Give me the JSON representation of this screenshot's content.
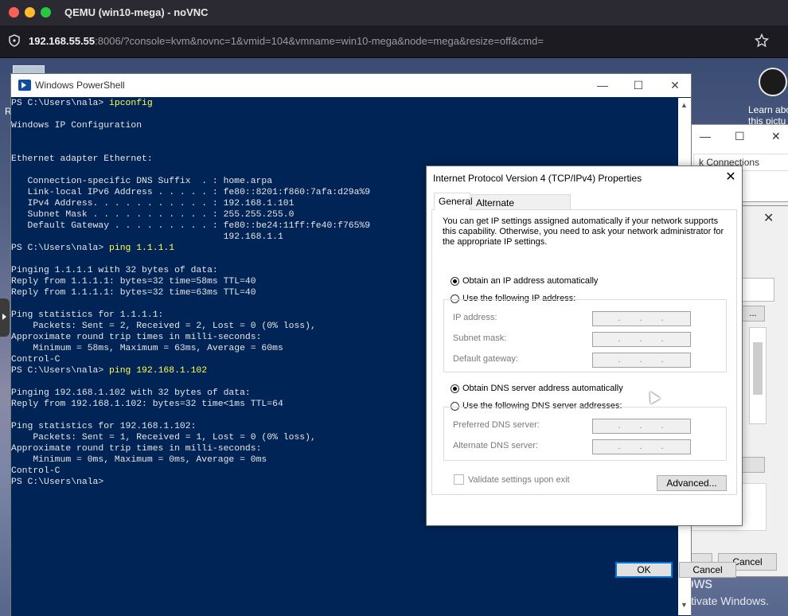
{
  "browser": {
    "window_title": "QEMU (win10-mega) - noVNC",
    "url_host": "192.168.55.55",
    "url_rest": ":8006/?console=kvm&novnc=1&vmid=104&vmname=win10-mega&node=mega&resize=off&cmd="
  },
  "desktop": {
    "letter_r": "R",
    "spotlight_line1": "Learn abo",
    "spotlight_line2": "this pictu",
    "activate_title": "Activate Windows",
    "activate_sub": "Go to Settings to activate Windows."
  },
  "bg_windows": {
    "search_text": "k Connections",
    "bg3_btn_label": "...",
    "ok": "OK",
    "cancel": "Cancel"
  },
  "powershell": {
    "title": "Windows PowerShell",
    "lines": [
      {
        "prompt": "PS C:\\Users\\nala> ",
        "cmd": "ipconfig"
      },
      {
        "text": ""
      },
      {
        "text": "Windows IP Configuration"
      },
      {
        "text": ""
      },
      {
        "text": ""
      },
      {
        "text": "Ethernet adapter Ethernet:"
      },
      {
        "text": ""
      },
      {
        "text": "   Connection-specific DNS Suffix  . : home.arpa"
      },
      {
        "text": "   Link-local IPv6 Address . . . . . : fe80::8201:f860:7afa:d29a%9"
      },
      {
        "text": "   IPv4 Address. . . . . . . . . . . : 192.168.1.101"
      },
      {
        "text": "   Subnet Mask . . . . . . . . . . . : 255.255.255.0"
      },
      {
        "text": "   Default Gateway . . . . . . . . . : fe80::be24:11ff:fe40:f765%9"
      },
      {
        "text": "                                       192.168.1.1"
      },
      {
        "prompt": "PS C:\\Users\\nala> ",
        "cmd": "ping 1.1.1.1"
      },
      {
        "text": ""
      },
      {
        "text": "Pinging 1.1.1.1 with 32 bytes of data:"
      },
      {
        "text": "Reply from 1.1.1.1: bytes=32 time=58ms TTL=40"
      },
      {
        "text": "Reply from 1.1.1.1: bytes=32 time=63ms TTL=40"
      },
      {
        "text": ""
      },
      {
        "text": "Ping statistics for 1.1.1.1:"
      },
      {
        "text": "    Packets: Sent = 2, Received = 2, Lost = 0 (0% loss),"
      },
      {
        "text": "Approximate round trip times in milli-seconds:"
      },
      {
        "text": "    Minimum = 58ms, Maximum = 63ms, Average = 60ms"
      },
      {
        "text": "Control-C"
      },
      {
        "prompt": "PS C:\\Users\\nala> ",
        "cmd": "ping 192.168.1.102"
      },
      {
        "text": ""
      },
      {
        "text": "Pinging 192.168.1.102 with 32 bytes of data:"
      },
      {
        "text": "Reply from 192.168.1.102: bytes=32 time<1ms TTL=64"
      },
      {
        "text": ""
      },
      {
        "text": "Ping statistics for 192.168.1.102:"
      },
      {
        "text": "    Packets: Sent = 1, Received = 1, Lost = 0 (0% loss),"
      },
      {
        "text": "Approximate round trip times in milli-seconds:"
      },
      {
        "text": "    Minimum = 0ms, Maximum = 0ms, Average = 0ms"
      },
      {
        "text": "Control-C"
      },
      {
        "prompt": "PS C:\\Users\\nala>",
        "cmd": ""
      }
    ]
  },
  "ipv4_dialog": {
    "title": "Internet Protocol Version 4 (TCP/IPv4) Properties",
    "tabs": [
      "General",
      "Alternate Configuration"
    ],
    "description": "You can get IP settings assigned automatically if your network supports this capability. Otherwise, you need to ask your network administrator for the appropriate IP settings.",
    "obtain_ip_auto": "Obtain an IP address automatically",
    "use_following_ip": "Use the following IP address:",
    "ip_address_label": "IP address:",
    "subnet_mask_label": "Subnet mask:",
    "default_gateway_label": "Default gateway:",
    "obtain_dns_auto": "Obtain DNS server address automatically",
    "use_following_dns": "Use the following DNS server addresses:",
    "preferred_dns_label": "Preferred DNS server:",
    "alternate_dns_label": "Alternate DNS server:",
    "ip_placeholder": "...",
    "validate_label": "Validate settings upon exit",
    "advanced_button": "Advanced...",
    "ok_button": "OK",
    "cancel_button": "Cancel",
    "ip_mode": "auto",
    "dns_mode": "auto"
  }
}
